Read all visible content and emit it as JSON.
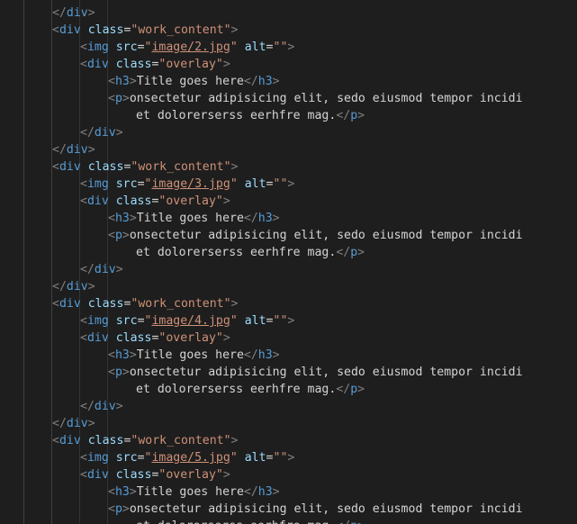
{
  "editor": {
    "theme": {
      "background": "#1e1e1e",
      "punct": "#808080",
      "tag": "#569cd6",
      "attr": "#9cdcfe",
      "string": "#ce9178",
      "text": "#d4d4d4",
      "indent_guide": "#404040"
    },
    "lines": [
      {
        "indent": 1,
        "segments": [
          {
            "t": "</",
            "k": "punct"
          },
          {
            "t": "div",
            "k": "tag"
          },
          {
            "t": ">",
            "k": "punct"
          }
        ]
      },
      {
        "indent": 1,
        "segments": [
          {
            "t": "<",
            "k": "punct"
          },
          {
            "t": "div",
            "k": "tag"
          },
          {
            "t": " ",
            "k": "text"
          },
          {
            "t": "class",
            "k": "attr"
          },
          {
            "t": "=",
            "k": "eq"
          },
          {
            "t": "\"work_content\"",
            "k": "str"
          },
          {
            "t": ">",
            "k": "punct"
          }
        ]
      },
      {
        "indent": 2,
        "segments": [
          {
            "t": "<",
            "k": "punct"
          },
          {
            "t": "img",
            "k": "tag"
          },
          {
            "t": " ",
            "k": "text"
          },
          {
            "t": "src",
            "k": "attr"
          },
          {
            "t": "=",
            "k": "eq"
          },
          {
            "t": "\"",
            "k": "str"
          },
          {
            "t": "image/2.jpg",
            "k": "link"
          },
          {
            "t": "\"",
            "k": "str"
          },
          {
            "t": " ",
            "k": "text"
          },
          {
            "t": "alt",
            "k": "attr"
          },
          {
            "t": "=",
            "k": "eq"
          },
          {
            "t": "\"\"",
            "k": "str"
          },
          {
            "t": ">",
            "k": "punct"
          }
        ]
      },
      {
        "indent": 2,
        "segments": [
          {
            "t": "<",
            "k": "punct"
          },
          {
            "t": "div",
            "k": "tag"
          },
          {
            "t": " ",
            "k": "text"
          },
          {
            "t": "class",
            "k": "attr"
          },
          {
            "t": "=",
            "k": "eq"
          },
          {
            "t": "\"overlay\"",
            "k": "str"
          },
          {
            "t": ">",
            "k": "punct"
          }
        ]
      },
      {
        "indent": 3,
        "segments": [
          {
            "t": "<",
            "k": "punct"
          },
          {
            "t": "h3",
            "k": "tag"
          },
          {
            "t": ">",
            "k": "punct"
          },
          {
            "t": "Title goes here",
            "k": "text"
          },
          {
            "t": "</",
            "k": "punct"
          },
          {
            "t": "h3",
            "k": "tag"
          },
          {
            "t": ">",
            "k": "punct"
          }
        ]
      },
      {
        "indent": 3,
        "segments": [
          {
            "t": "<",
            "k": "punct"
          },
          {
            "t": "p",
            "k": "tag"
          },
          {
            "t": ">",
            "k": "punct"
          },
          {
            "t": "onsectetur adipisicing elit, sedo eiusmod tempor incidi",
            "k": "text"
          }
        ]
      },
      {
        "indent": 4,
        "segments": [
          {
            "t": "et dolorerserss eerhfre mag.",
            "k": "text"
          },
          {
            "t": "</",
            "k": "punct"
          },
          {
            "t": "p",
            "k": "tag"
          },
          {
            "t": ">",
            "k": "punct"
          }
        ]
      },
      {
        "indent": 2,
        "segments": [
          {
            "t": "</",
            "k": "punct"
          },
          {
            "t": "div",
            "k": "tag"
          },
          {
            "t": ">",
            "k": "punct"
          }
        ]
      },
      {
        "indent": 1,
        "segments": [
          {
            "t": "</",
            "k": "punct"
          },
          {
            "t": "div",
            "k": "tag"
          },
          {
            "t": ">",
            "k": "punct"
          }
        ]
      },
      {
        "indent": 1,
        "segments": [
          {
            "t": "<",
            "k": "punct"
          },
          {
            "t": "div",
            "k": "tag"
          },
          {
            "t": " ",
            "k": "text"
          },
          {
            "t": "class",
            "k": "attr"
          },
          {
            "t": "=",
            "k": "eq"
          },
          {
            "t": "\"work_content\"",
            "k": "str"
          },
          {
            "t": ">",
            "k": "punct"
          }
        ]
      },
      {
        "indent": 2,
        "segments": [
          {
            "t": "<",
            "k": "punct"
          },
          {
            "t": "img",
            "k": "tag"
          },
          {
            "t": " ",
            "k": "text"
          },
          {
            "t": "src",
            "k": "attr"
          },
          {
            "t": "=",
            "k": "eq"
          },
          {
            "t": "\"",
            "k": "str"
          },
          {
            "t": "image/3.jpg",
            "k": "link"
          },
          {
            "t": "\"",
            "k": "str"
          },
          {
            "t": " ",
            "k": "text"
          },
          {
            "t": "alt",
            "k": "attr"
          },
          {
            "t": "=",
            "k": "eq"
          },
          {
            "t": "\"\"",
            "k": "str"
          },
          {
            "t": ">",
            "k": "punct"
          }
        ]
      },
      {
        "indent": 2,
        "segments": [
          {
            "t": "<",
            "k": "punct"
          },
          {
            "t": "div",
            "k": "tag"
          },
          {
            "t": " ",
            "k": "text"
          },
          {
            "t": "class",
            "k": "attr"
          },
          {
            "t": "=",
            "k": "eq"
          },
          {
            "t": "\"overlay\"",
            "k": "str"
          },
          {
            "t": ">",
            "k": "punct"
          }
        ]
      },
      {
        "indent": 3,
        "segments": [
          {
            "t": "<",
            "k": "punct"
          },
          {
            "t": "h3",
            "k": "tag"
          },
          {
            "t": ">",
            "k": "punct"
          },
          {
            "t": "Title goes here",
            "k": "text"
          },
          {
            "t": "</",
            "k": "punct"
          },
          {
            "t": "h3",
            "k": "tag"
          },
          {
            "t": ">",
            "k": "punct"
          }
        ]
      },
      {
        "indent": 3,
        "segments": [
          {
            "t": "<",
            "k": "punct"
          },
          {
            "t": "p",
            "k": "tag"
          },
          {
            "t": ">",
            "k": "punct"
          },
          {
            "t": "onsectetur adipisicing elit, sedo eiusmod tempor incidi",
            "k": "text"
          }
        ]
      },
      {
        "indent": 4,
        "segments": [
          {
            "t": "et dolorerserss eerhfre mag.",
            "k": "text"
          },
          {
            "t": "</",
            "k": "punct"
          },
          {
            "t": "p",
            "k": "tag"
          },
          {
            "t": ">",
            "k": "punct"
          }
        ]
      },
      {
        "indent": 2,
        "segments": [
          {
            "t": "</",
            "k": "punct"
          },
          {
            "t": "div",
            "k": "tag"
          },
          {
            "t": ">",
            "k": "punct"
          }
        ]
      },
      {
        "indent": 1,
        "segments": [
          {
            "t": "</",
            "k": "punct"
          },
          {
            "t": "div",
            "k": "tag"
          },
          {
            "t": ">",
            "k": "punct"
          }
        ]
      },
      {
        "indent": 1,
        "segments": [
          {
            "t": "<",
            "k": "punct"
          },
          {
            "t": "div",
            "k": "tag"
          },
          {
            "t": " ",
            "k": "text"
          },
          {
            "t": "class",
            "k": "attr"
          },
          {
            "t": "=",
            "k": "eq"
          },
          {
            "t": "\"work_content\"",
            "k": "str"
          },
          {
            "t": ">",
            "k": "punct"
          }
        ]
      },
      {
        "indent": 2,
        "segments": [
          {
            "t": "<",
            "k": "punct"
          },
          {
            "t": "img",
            "k": "tag"
          },
          {
            "t": " ",
            "k": "text"
          },
          {
            "t": "src",
            "k": "attr"
          },
          {
            "t": "=",
            "k": "eq"
          },
          {
            "t": "\"",
            "k": "str"
          },
          {
            "t": "image/4.jpg",
            "k": "link"
          },
          {
            "t": "\"",
            "k": "str"
          },
          {
            "t": " ",
            "k": "text"
          },
          {
            "t": "alt",
            "k": "attr"
          },
          {
            "t": "=",
            "k": "eq"
          },
          {
            "t": "\"\"",
            "k": "str"
          },
          {
            "t": ">",
            "k": "punct"
          }
        ]
      },
      {
        "indent": 2,
        "segments": [
          {
            "t": "<",
            "k": "punct"
          },
          {
            "t": "div",
            "k": "tag"
          },
          {
            "t": " ",
            "k": "text"
          },
          {
            "t": "class",
            "k": "attr"
          },
          {
            "t": "=",
            "k": "eq"
          },
          {
            "t": "\"overlay\"",
            "k": "str"
          },
          {
            "t": ">",
            "k": "punct"
          }
        ]
      },
      {
        "indent": 3,
        "segments": [
          {
            "t": "<",
            "k": "punct"
          },
          {
            "t": "h3",
            "k": "tag"
          },
          {
            "t": ">",
            "k": "punct"
          },
          {
            "t": "Title goes here",
            "k": "text"
          },
          {
            "t": "</",
            "k": "punct"
          },
          {
            "t": "h3",
            "k": "tag"
          },
          {
            "t": ">",
            "k": "punct"
          }
        ]
      },
      {
        "indent": 3,
        "segments": [
          {
            "t": "<",
            "k": "punct"
          },
          {
            "t": "p",
            "k": "tag"
          },
          {
            "t": ">",
            "k": "punct"
          },
          {
            "t": "onsectetur adipisicing elit, sedo eiusmod tempor incidi",
            "k": "text"
          }
        ]
      },
      {
        "indent": 4,
        "segments": [
          {
            "t": "et dolorerserss eerhfre mag.",
            "k": "text"
          },
          {
            "t": "</",
            "k": "punct"
          },
          {
            "t": "p",
            "k": "tag"
          },
          {
            "t": ">",
            "k": "punct"
          }
        ]
      },
      {
        "indent": 2,
        "segments": [
          {
            "t": "</",
            "k": "punct"
          },
          {
            "t": "div",
            "k": "tag"
          },
          {
            "t": ">",
            "k": "punct"
          }
        ]
      },
      {
        "indent": 1,
        "segments": [
          {
            "t": "</",
            "k": "punct"
          },
          {
            "t": "div",
            "k": "tag"
          },
          {
            "t": ">",
            "k": "punct"
          }
        ]
      },
      {
        "indent": 1,
        "segments": [
          {
            "t": "<",
            "k": "punct"
          },
          {
            "t": "div",
            "k": "tag"
          },
          {
            "t": " ",
            "k": "text"
          },
          {
            "t": "class",
            "k": "attr"
          },
          {
            "t": "=",
            "k": "eq"
          },
          {
            "t": "\"work_content\"",
            "k": "str"
          },
          {
            "t": ">",
            "k": "punct"
          }
        ]
      },
      {
        "indent": 2,
        "segments": [
          {
            "t": "<",
            "k": "punct"
          },
          {
            "t": "img",
            "k": "tag"
          },
          {
            "t": " ",
            "k": "text"
          },
          {
            "t": "src",
            "k": "attr"
          },
          {
            "t": "=",
            "k": "eq"
          },
          {
            "t": "\"",
            "k": "str"
          },
          {
            "t": "image/5.jpg",
            "k": "link"
          },
          {
            "t": "\"",
            "k": "str"
          },
          {
            "t": " ",
            "k": "text"
          },
          {
            "t": "alt",
            "k": "attr"
          },
          {
            "t": "=",
            "k": "eq"
          },
          {
            "t": "\"\"",
            "k": "str"
          },
          {
            "t": ">",
            "k": "punct"
          }
        ]
      },
      {
        "indent": 2,
        "segments": [
          {
            "t": "<",
            "k": "punct"
          },
          {
            "t": "div",
            "k": "tag"
          },
          {
            "t": " ",
            "k": "text"
          },
          {
            "t": "class",
            "k": "attr"
          },
          {
            "t": "=",
            "k": "eq"
          },
          {
            "t": "\"overlay\"",
            "k": "str"
          },
          {
            "t": ">",
            "k": "punct"
          }
        ]
      },
      {
        "indent": 3,
        "segments": [
          {
            "t": "<",
            "k": "punct"
          },
          {
            "t": "h3",
            "k": "tag"
          },
          {
            "t": ">",
            "k": "punct"
          },
          {
            "t": "Title goes here",
            "k": "text"
          },
          {
            "t": "</",
            "k": "punct"
          },
          {
            "t": "h3",
            "k": "tag"
          },
          {
            "t": ">",
            "k": "punct"
          }
        ]
      },
      {
        "indent": 3,
        "segments": [
          {
            "t": "<",
            "k": "punct"
          },
          {
            "t": "p",
            "k": "tag"
          },
          {
            "t": ">",
            "k": "punct"
          },
          {
            "t": "onsectetur adipisicing elit, sedo eiusmod tempor incidi",
            "k": "text"
          }
        ]
      },
      {
        "indent": 4,
        "segments": [
          {
            "t": "et dolorerserss eerhfre mag.",
            "k": "text"
          },
          {
            "t": "</",
            "k": "punct"
          },
          {
            "t": "p",
            "k": "tag"
          },
          {
            "t": ">",
            "k": "punct"
          }
        ]
      }
    ]
  }
}
